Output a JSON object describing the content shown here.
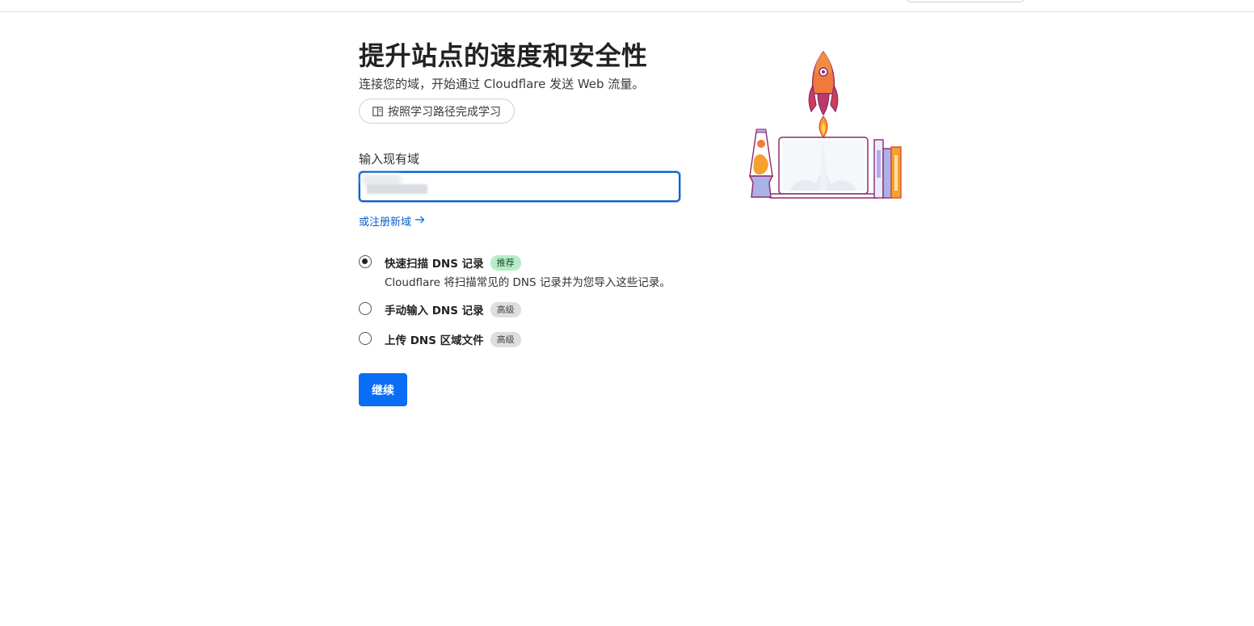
{
  "page": {
    "title": "提升站点的速度和安全性",
    "subtitle": "连接您的域，开始通过 Cloudflare 发送 Web 流量。",
    "learn_button": "按照学习路径完成学习"
  },
  "domain_form": {
    "label": "输入现有域",
    "value": "",
    "register_link": "或注册新域"
  },
  "dns_options": [
    {
      "title": "快速扫描 DNS 记录",
      "badge": "推荐",
      "description": "Cloudflare 将扫描常见的 DNS 记录并为您导入这些记录。",
      "selected": true
    },
    {
      "title": "手动输入 DNS 记录",
      "badge": "高级",
      "selected": false
    },
    {
      "title": "上传 DNS 区域文件",
      "badge": "高级",
      "selected": false
    }
  ],
  "continue_label": "继续",
  "colors": {
    "accent": "#0a6ef5",
    "link": "#0a60c6",
    "badge_recommended": "#b8ecc8",
    "badge_advanced": "#dedede"
  },
  "icons": {
    "learn_button": "book-icon",
    "register_link": "arrow-right-icon",
    "illustration": "rocket-laptop-illustration"
  }
}
